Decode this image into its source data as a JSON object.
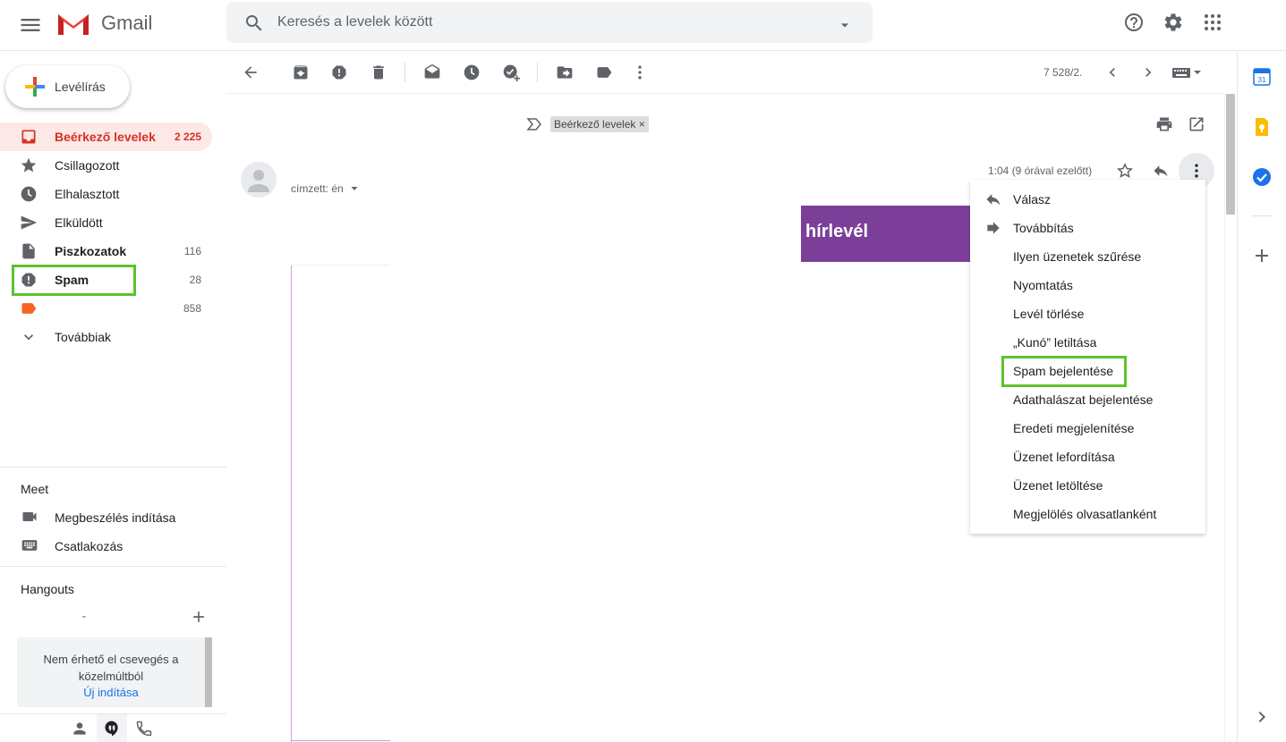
{
  "header": {
    "app_name": "Gmail",
    "search_placeholder": "Keresés a levelek között"
  },
  "sidebar": {
    "compose_label": "Levélírás",
    "items": [
      {
        "label": "Beérkező levelek",
        "count": "2 225"
      },
      {
        "label": "Csillagozott",
        "count": ""
      },
      {
        "label": "Elhalasztott",
        "count": ""
      },
      {
        "label": "Elküldött",
        "count": ""
      },
      {
        "label": "Piszkozatok",
        "count": "116"
      },
      {
        "label": "Spam",
        "count": "28"
      },
      {
        "label": "",
        "count": "858"
      },
      {
        "label": "Továbbiak",
        "count": ""
      }
    ],
    "meet": {
      "title": "Meet",
      "items": [
        "Megbeszélés indítása",
        "Csatlakozás"
      ]
    },
    "hangouts": {
      "title": "Hangouts",
      "empty_message": "Nem érhető el csevegés a közelmúltból",
      "start_link": "Új indítása"
    }
  },
  "toolbar": {
    "pager": "7 528/2."
  },
  "message": {
    "label_chip": "Beérkező levelek ×",
    "recipient": "címzett: én",
    "timestamp": "1:04 (9 órával ezelőtt)",
    "banner_text": "hírlevél"
  },
  "more_menu": {
    "items": [
      "Válasz",
      "Továbbítás",
      "Ilyen üzenetek szűrése",
      "Nyomtatás",
      "Levél törlése",
      "„Kunó” letiltása",
      "Spam bejelentése",
      "Adathalászat bejelentése",
      "Eredeti megjelenítése",
      "Üzenet lefordítása",
      "Üzenet letöltése",
      "Megjelölés olvasatlanként"
    ]
  },
  "colors": {
    "accent_red": "#d93025",
    "highlight_green": "#5cc32b",
    "banner_purple": "#7b3f9a",
    "label_orange": "#f46524"
  }
}
